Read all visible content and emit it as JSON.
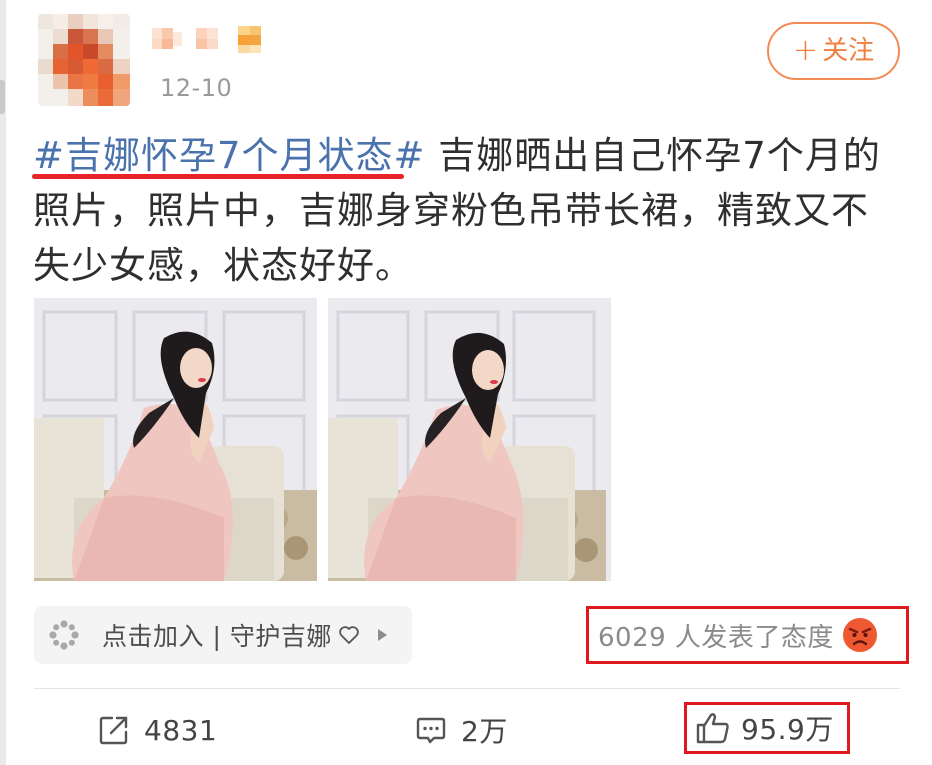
{
  "post": {
    "time": "12-10",
    "follow_plus": "+",
    "follow_label": "关注",
    "hashtag": "#吉娜怀孕7个月状态#",
    "text": " 吉娜晒出自己怀孕7个月的照片，照片中，吉娜身穿粉色吊带长裙，精致又不失少女感，状态好好。"
  },
  "super_topic": {
    "label": "点击加入 | 守护吉娜",
    "icon": "super-topic-icon"
  },
  "attitude": {
    "label": "6029 人发表了态度",
    "icon": "angry-face-icon"
  },
  "actions": {
    "repost_count": "4831",
    "comment_count": "2万",
    "like_count": "95.9万"
  },
  "colors": {
    "accent_orange": "#f07f3f",
    "link_blue": "#4a72ad",
    "highlight_red": "#e0191f"
  }
}
